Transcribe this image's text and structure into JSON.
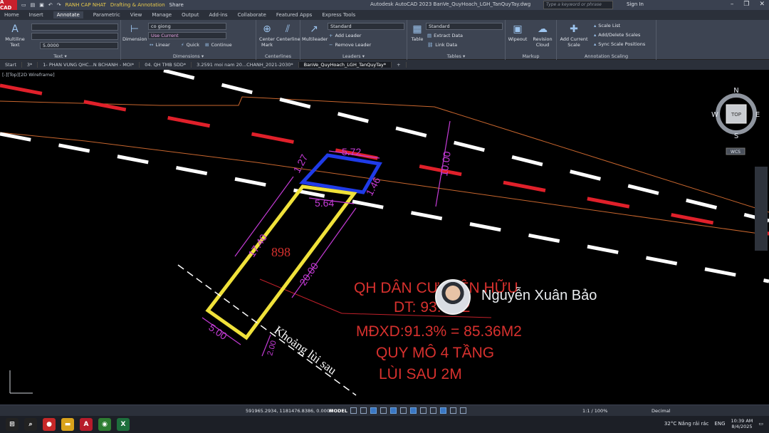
{
  "titlebar": {
    "logo": "A CAD",
    "workspace_layer": "RANH CAP NHAT",
    "workspace": "Drafting & Annotation",
    "share": "Share",
    "app_title": "Autodesk AutoCAD 2023   BanVe_QuyHoach_LGH_TanQuyTay.dwg",
    "search_placeholder": "Type a keyword or phrase",
    "sign_in": "Sign In"
  },
  "ribbon_tabs": [
    "Home",
    "Insert",
    "Annotate",
    "Parametric",
    "View",
    "Manage",
    "Output",
    "Add-ins",
    "Collaborate",
    "Featured Apps",
    "Express Tools"
  ],
  "ribbon": {
    "text_panel": {
      "label": "Text ▾",
      "multiline": "Multiline Text",
      "style": "5.0000"
    },
    "dimensions_panel": {
      "label": "Dimensions ▾",
      "button": "Dimension",
      "style": "co giong",
      "layer": "Use Current",
      "linear": "Linear",
      "quick": "Quick",
      "continue": "Continue"
    },
    "centerlines_panel": {
      "label": "Centerlines",
      "center_mark": "Center Mark",
      "centerline": "Centerline"
    },
    "leaders_panel": {
      "label": "Leaders ▾",
      "button": "Multileader",
      "style": "Standard",
      "add": "Add Leader",
      "remove": "Remove Leader"
    },
    "tables_panel": {
      "label": "Tables ▾",
      "button": "Table",
      "style": "Standard",
      "extract": "Extract Data",
      "link": "Link Data"
    },
    "markup_panel": {
      "label": "Markup",
      "wipeout": "Wipeout",
      "revision": "Revision Cloud"
    },
    "scaling_panel": {
      "label": "Annotation Scaling",
      "add_scale": "Add Current Scale",
      "scale_list": "Scale List",
      "add_delete": "Add/Delete Scales",
      "sync": "Sync Scale Positions"
    }
  },
  "doc_tabs": [
    "Start",
    "3*",
    "1- PHAN VUNG QHC...N BCHANH - MOI*",
    "04. QH TMB SDD*",
    "3.2591 moi nam 20...CHANH_2021-2030*",
    "BanVe_QuyHoach_LGH_TanQuyTay*"
  ],
  "viewport": {
    "label": "[-][Top][2D Wireframe]",
    "viewcube": {
      "n": "N",
      "s": "S",
      "e": "E",
      "w": "W",
      "face": "TOP",
      "ucs": "WCS"
    },
    "drawing": {
      "dims": {
        "top_width": "5.72",
        "left_small": "1.27",
        "right_small": "1.46",
        "mid_width": "5.64",
        "road": "10.00",
        "left_side": "17.40",
        "right_side": "20.00",
        "bottom": "5.00",
        "setback": "2.00"
      },
      "lot_number": "898",
      "setback_label": "Khoảng lùi sau",
      "notes": [
        "QH DÂN CƯ HIỆN HỮU",
        "DT: 93.5M2",
        "MĐXD:91.3% = 85.36M2",
        "QUY MÔ 4 TẦNG",
        "LÙI SAU 2M"
      ]
    },
    "watermark": "Nguyễn Xuân Bảo"
  },
  "statusbar": {
    "coords": "591965.2934, 1181476.8386, 0.0000",
    "model": "MODEL",
    "scale": "1:1 / 100%",
    "units": "Decimal"
  },
  "taskbar": {
    "weather": "32°C  Nắng rải rác",
    "lang": "ENG",
    "time": "10:39 AM",
    "date": "8/4/2025"
  }
}
